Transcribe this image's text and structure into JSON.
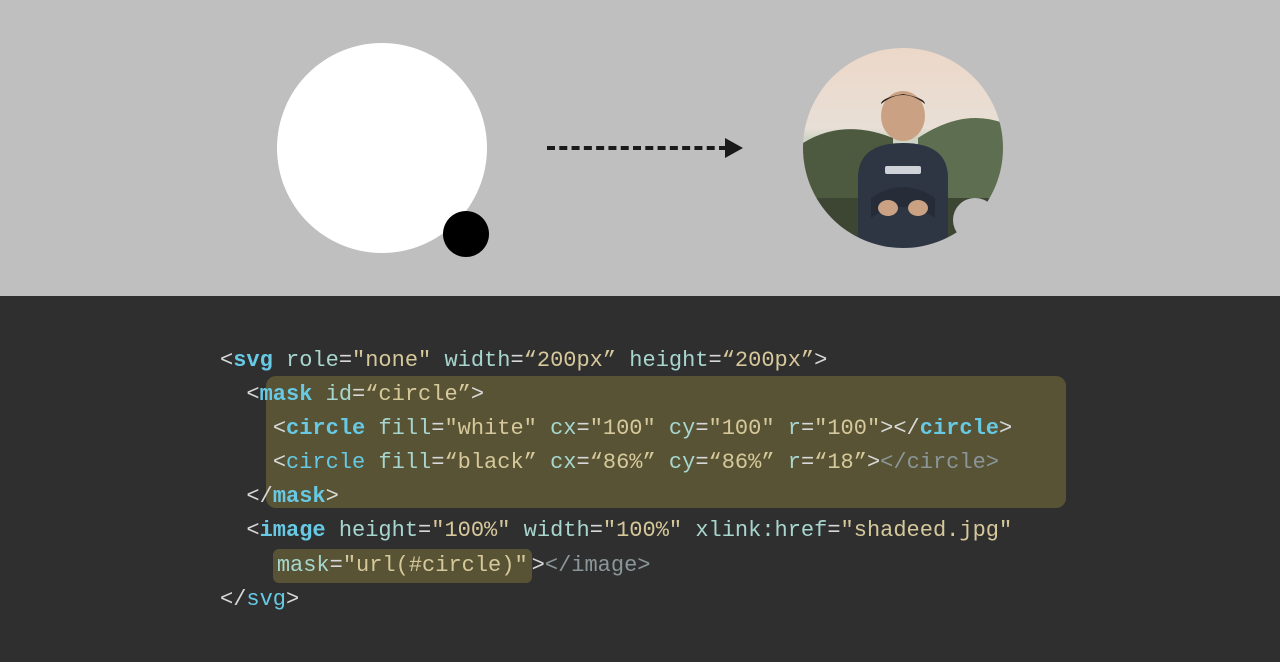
{
  "svg_mask": {
    "big_circle": {
      "fill": "white",
      "cx": "100",
      "cy": "100",
      "r": "100"
    },
    "small_circle": {
      "fill": "black",
      "cx": "86%",
      "cy": "86%",
      "r": "18"
    }
  },
  "code": {
    "l1": {
      "tag": "svg",
      "role_attr": "role",
      "role_val": "\"none\"",
      "w_attr": "width",
      "w_val": "“200px”",
      "h_attr": "height",
      "h_val": "“200px”"
    },
    "l2": {
      "tag": "mask",
      "id_attr": "id",
      "id_val": "“circle”"
    },
    "l3": {
      "tag": "circle",
      "fill_attr": "fill",
      "fill_val": "\"white\"",
      "cx_attr": "cx",
      "cx_val": "\"100\"",
      "cy_attr": "cy",
      "cy_val": "\"100\"",
      "r_attr": "r",
      "r_val": "\"100\"",
      "close": "circle"
    },
    "l4": {
      "tag": "circle",
      "fill_attr": "fill",
      "fill_val": "“black”",
      "cx_attr": "cx",
      "cx_val": "“86%”",
      "cy_attr": "cy",
      "cy_val": "“86%”",
      "r_attr": "r",
      "r_val": "“18”",
      "close": "circle"
    },
    "l5": {
      "close": "mask"
    },
    "l6": {
      "tag": "image",
      "h_attr": "height",
      "h_val": "\"100%\"",
      "w_attr": "width",
      "w_val": "\"100%\"",
      "href_attr": "xlink:href",
      "href_val": "\"shadeed.jpg\""
    },
    "l7": {
      "mask_attr": "mask",
      "mask_val": "\"url(#circle)\"",
      "close": "image"
    },
    "l8": {
      "close": "svg"
    }
  }
}
